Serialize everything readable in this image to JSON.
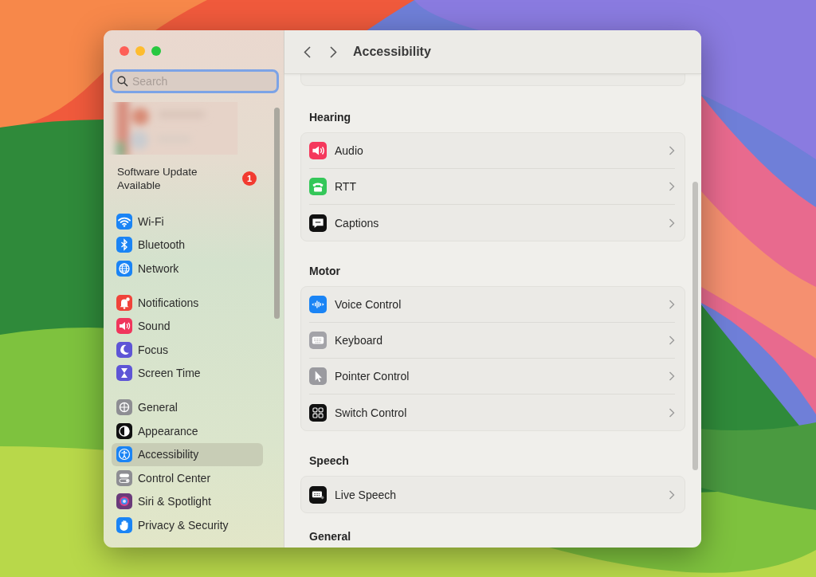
{
  "window": {
    "title": "Accessibility"
  },
  "sidebar": {
    "search": {
      "placeholder": "Search",
      "focused": true
    },
    "update": {
      "label": "Software Update Available",
      "badge": "1"
    },
    "groups": [
      {
        "items": [
          {
            "label": "Wi-Fi",
            "selected": false,
            "color": "#1a84f5"
          },
          {
            "label": "Bluetooth",
            "selected": false,
            "color": "#1a84f5"
          },
          {
            "label": "Network",
            "selected": false,
            "color": "#1a84f5"
          }
        ]
      },
      {
        "items": [
          {
            "label": "Notifications",
            "selected": false,
            "color": "#f0433a"
          },
          {
            "label": "Sound",
            "selected": false,
            "color": "#f0365c"
          },
          {
            "label": "Focus",
            "selected": false,
            "color": "#5e55d6"
          },
          {
            "label": "Screen Time",
            "selected": false,
            "color": "#5e55d6"
          }
        ]
      },
      {
        "items": [
          {
            "label": "General",
            "selected": false,
            "color": "#8e8e93"
          },
          {
            "label": "Appearance",
            "selected": false,
            "color": "#111111"
          },
          {
            "label": "Accessibility",
            "selected": true,
            "color": "#1a84f5"
          },
          {
            "label": "Control Center",
            "selected": false,
            "color": "#8e8e93"
          },
          {
            "label": "Siri & Spotlight",
            "selected": false,
            "color": "#6a3a7a"
          },
          {
            "label": "Privacy & Security",
            "selected": false,
            "color": "#1a84f5"
          }
        ]
      }
    ]
  },
  "content": {
    "sections": [
      {
        "title": "Hearing",
        "rows": [
          {
            "label": "Audio",
            "color": "#f5385c"
          },
          {
            "label": "RTT",
            "color": "#34c759"
          },
          {
            "label": "Captions",
            "color": "#111111"
          }
        ]
      },
      {
        "title": "Motor",
        "rows": [
          {
            "label": "Voice Control",
            "color": "#1a84f5"
          },
          {
            "label": "Keyboard",
            "color": "#a3a3a8"
          },
          {
            "label": "Pointer Control",
            "color": "#9a9a9f"
          },
          {
            "label": "Switch Control",
            "color": "#111111"
          }
        ]
      },
      {
        "title": "Speech",
        "rows": [
          {
            "label": "Live Speech",
            "color": "#111111"
          }
        ]
      },
      {
        "title": "General"
      }
    ]
  }
}
